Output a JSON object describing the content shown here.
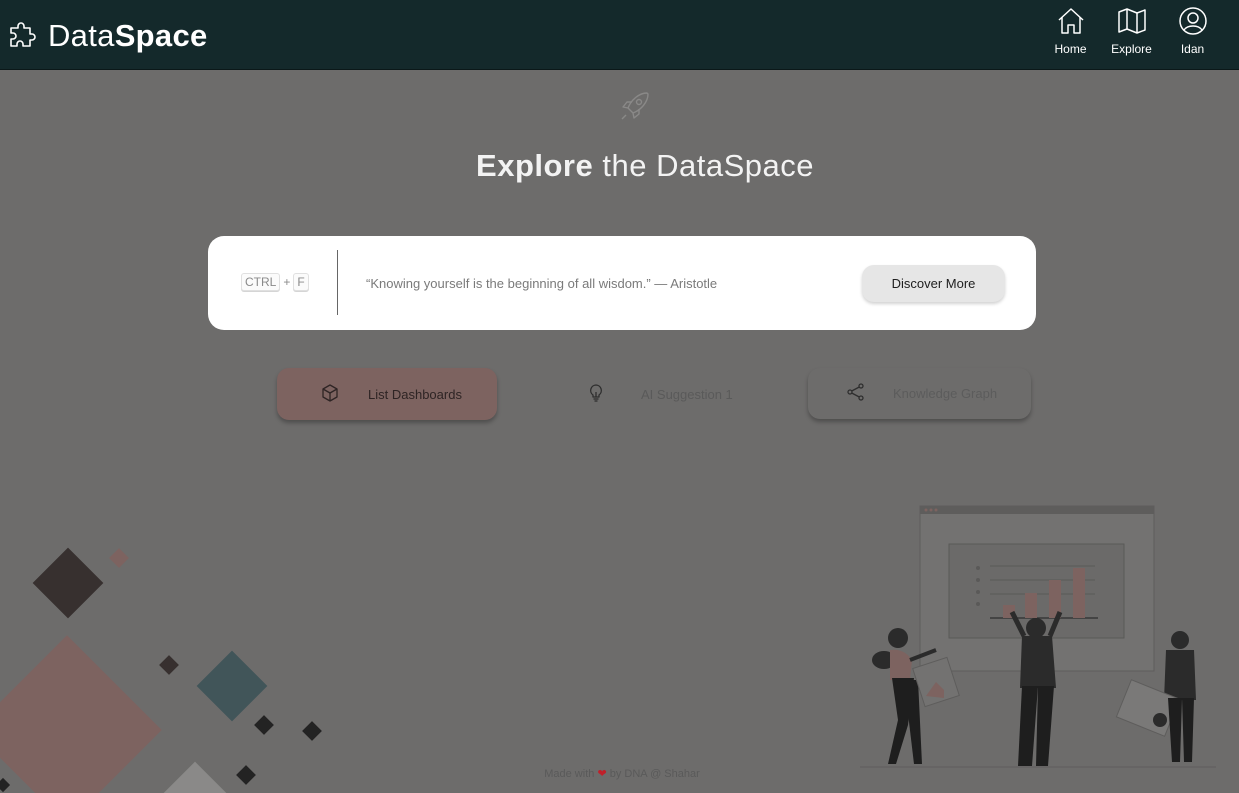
{
  "header": {
    "brand_prefix": "Data",
    "brand_suffix": "Space",
    "nav": [
      {
        "label": "Home",
        "icon": "home-icon"
      },
      {
        "label": "Explore",
        "icon": "map-icon"
      },
      {
        "label": "Idan",
        "icon": "user-icon"
      }
    ]
  },
  "hero": {
    "title_bold": "Explore",
    "title_rest": "the DataSpace",
    "icon": "rocket-icon"
  },
  "search": {
    "shortcut_key1": "CTRL",
    "shortcut_plus": "+",
    "shortcut_key2": "F",
    "quote": "“Knowing yourself is the beginning of all wisdom.” — Aristotle",
    "button_label": "Discover More"
  },
  "actions": [
    {
      "label": "List Dashboards",
      "icon": "cube-icon"
    },
    {
      "label": "AI Suggestion 1",
      "icon": "lightbulb-icon"
    },
    {
      "label": "Knowledge Graph",
      "icon": "share-icon"
    }
  ],
  "footer": {
    "prefix": "Made with",
    "suffix": "by DNA @ Shahar"
  },
  "colors": {
    "header_bg": "#14292b",
    "page_overlay": "#6d6c6b",
    "accent_rose": "#7d6360",
    "heart": "#c0202a"
  }
}
